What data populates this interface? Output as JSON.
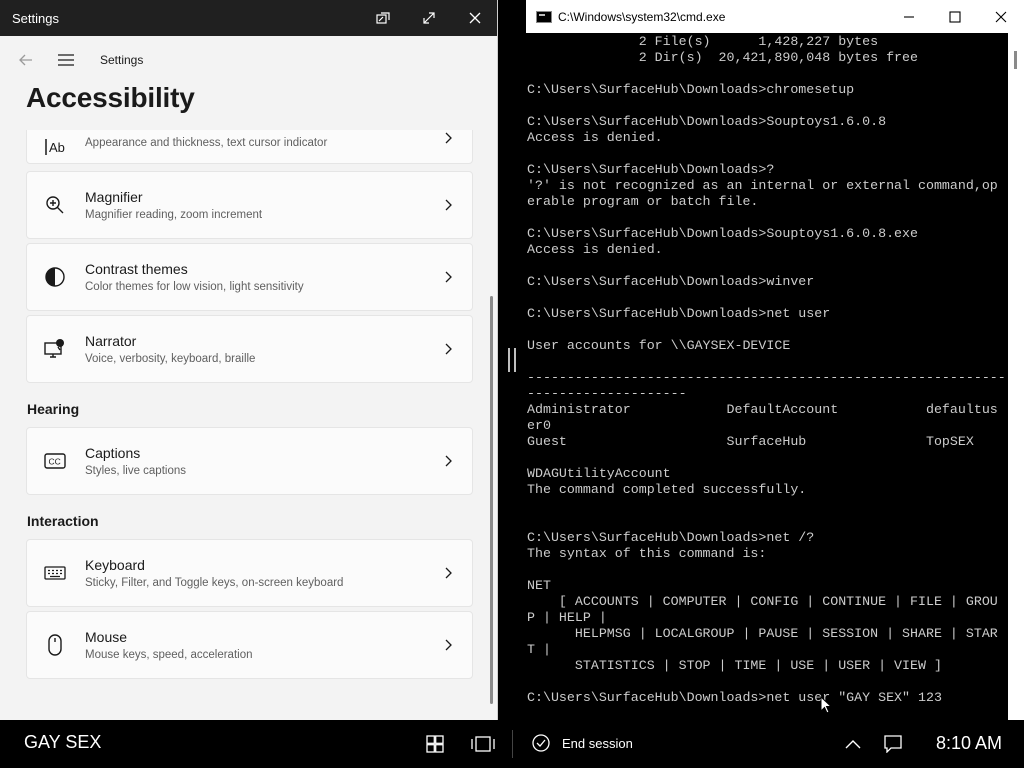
{
  "settings": {
    "window_title": "Settings",
    "nav_label": "Settings",
    "page_title": "Accessibility",
    "cards_vision": [
      {
        "title": "",
        "subtitle": "Appearance and thickness, text cursor indicator",
        "icon": "text-cursor-icon"
      },
      {
        "title": "Magnifier",
        "subtitle": "Magnifier reading, zoom increment",
        "icon": "magnifier-icon"
      },
      {
        "title": "Contrast themes",
        "subtitle": "Color themes for low vision, light sensitivity",
        "icon": "contrast-icon"
      },
      {
        "title": "Narrator",
        "subtitle": "Voice, verbosity, keyboard, braille",
        "icon": "narrator-icon"
      }
    ],
    "section_hearing": "Hearing",
    "cards_hearing": [
      {
        "title": "Captions",
        "subtitle": "Styles, live captions",
        "icon": "captions-icon"
      }
    ],
    "section_interaction": "Interaction",
    "cards_interaction": [
      {
        "title": "Keyboard",
        "subtitle": "Sticky, Filter, and Toggle keys, on-screen keyboard",
        "icon": "keyboard-icon"
      },
      {
        "title": "Mouse",
        "subtitle": "Mouse keys, speed, acceleration",
        "icon": "mouse-icon"
      }
    ]
  },
  "cmd": {
    "window_title": "C:\\Windows\\system32\\cmd.exe",
    "output": "              2 File(s)      1,428,227 bytes\n              2 Dir(s)  20,421,890,048 bytes free\n\nC:\\Users\\SurfaceHub\\Downloads>chromesetup\n\nC:\\Users\\SurfaceHub\\Downloads>Souptoys1.6.0.8\nAccess is denied.\n\nC:\\Users\\SurfaceHub\\Downloads>?\n'?' is not recognized as an internal or external command,op\nerable program or batch file.\n\nC:\\Users\\SurfaceHub\\Downloads>Souptoys1.6.0.8.exe\nAccess is denied.\n\nC:\\Users\\SurfaceHub\\Downloads>winver\n\nC:\\Users\\SurfaceHub\\Downloads>net user\n\nUser accounts for \\\\GAYSEX-DEVICE\n\n-------------------------------------------------------------\n--------------------\nAdministrator            DefaultAccount           defaultus\ner0\nGuest                    SurfaceHub               TopSEX\n\nWDAGUtilityAccount\nThe command completed successfully.\n\n\nC:\\Users\\SurfaceHub\\Downloads>net /?\nThe syntax of this command is:\n\nNET\n    [ ACCOUNTS | COMPUTER | CONFIG | CONTINUE | FILE | GROU\nP | HELP |\n      HELPMSG | LOCALGROUP | PAUSE | SESSION | SHARE | STAR\nT |\n      STATISTICS | STOP | TIME | USE | USER | VIEW ]\n\nC:\\Users\\SurfaceHub\\Downloads>net user \"GAY SEX\" 123"
  },
  "taskbar": {
    "device_name": "GAY SEX",
    "end_session_label": "End session",
    "time": "8:10 AM"
  },
  "colors": {
    "titlebar_dark": "#202020",
    "settings_bg": "#f3f3f3",
    "card_bg": "#fbfbfb",
    "console_text": "#cccccc"
  }
}
